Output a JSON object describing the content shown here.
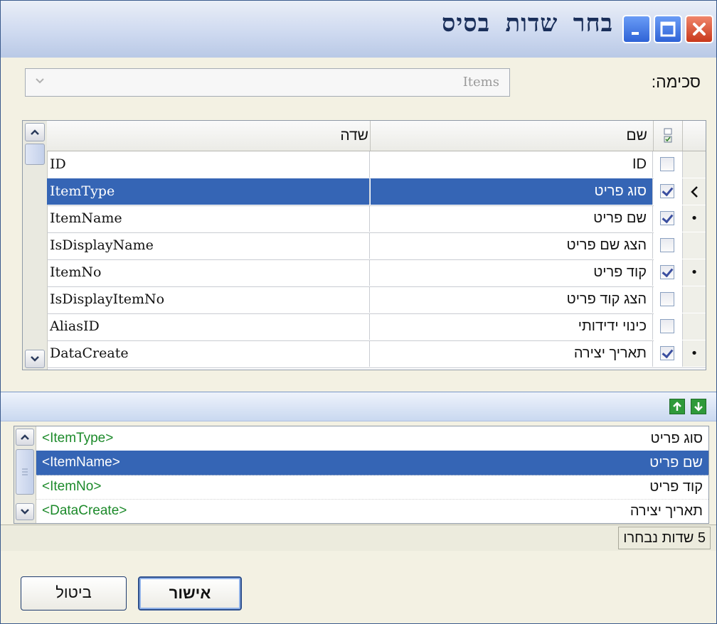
{
  "window": {
    "title": "בחר שדות בסיס",
    "minimize_icon": "minimize-icon",
    "maximize_icon": "maximize-icon",
    "close_icon": "close-icon"
  },
  "schema": {
    "label": "סכימה:",
    "value": "Items"
  },
  "grid": {
    "columns": {
      "field": "שדה",
      "name": "שם"
    },
    "rows": [
      {
        "field": "ID",
        "name": "ID",
        "checked": false,
        "marker": ""
      },
      {
        "field": "ItemType",
        "name": "סוג פריט",
        "checked": true,
        "marker": "current",
        "selected": true
      },
      {
        "field": "ItemName",
        "name": "שם פריט",
        "checked": true,
        "marker": "•"
      },
      {
        "field": "IsDisplayName",
        "name": "הצג שם פריט",
        "checked": false,
        "marker": ""
      },
      {
        "field": "ItemNo",
        "name": "קוד פריט",
        "checked": true,
        "marker": "•"
      },
      {
        "field": "IsDisplayItemNo",
        "name": "הצג קוד פריט",
        "checked": false,
        "marker": ""
      },
      {
        "field": "AliasID",
        "name": "כינוי ידידותי",
        "checked": false,
        "marker": ""
      },
      {
        "field": "DataCreate",
        "name": "תאריך יצירה",
        "checked": true,
        "marker": "•"
      }
    ]
  },
  "selected_list": {
    "items": [
      {
        "field": "<ItemType>",
        "name": "סוג פריט"
      },
      {
        "field": "<ItemName>",
        "name": "שם פריט",
        "selected": true
      },
      {
        "field": "<ItemNo>",
        "name": "קוד פריט"
      },
      {
        "field": "<DataCreate>",
        "name": "תאריך יצירה"
      }
    ]
  },
  "status": {
    "text": "5 שדות נבחרו"
  },
  "buttons": {
    "ok": "אישור",
    "cancel": "ביטול"
  },
  "colors": {
    "selection": "#3565b5",
    "field_tag": "#1c8a2a",
    "move_arrow": "#2f9a3a"
  }
}
